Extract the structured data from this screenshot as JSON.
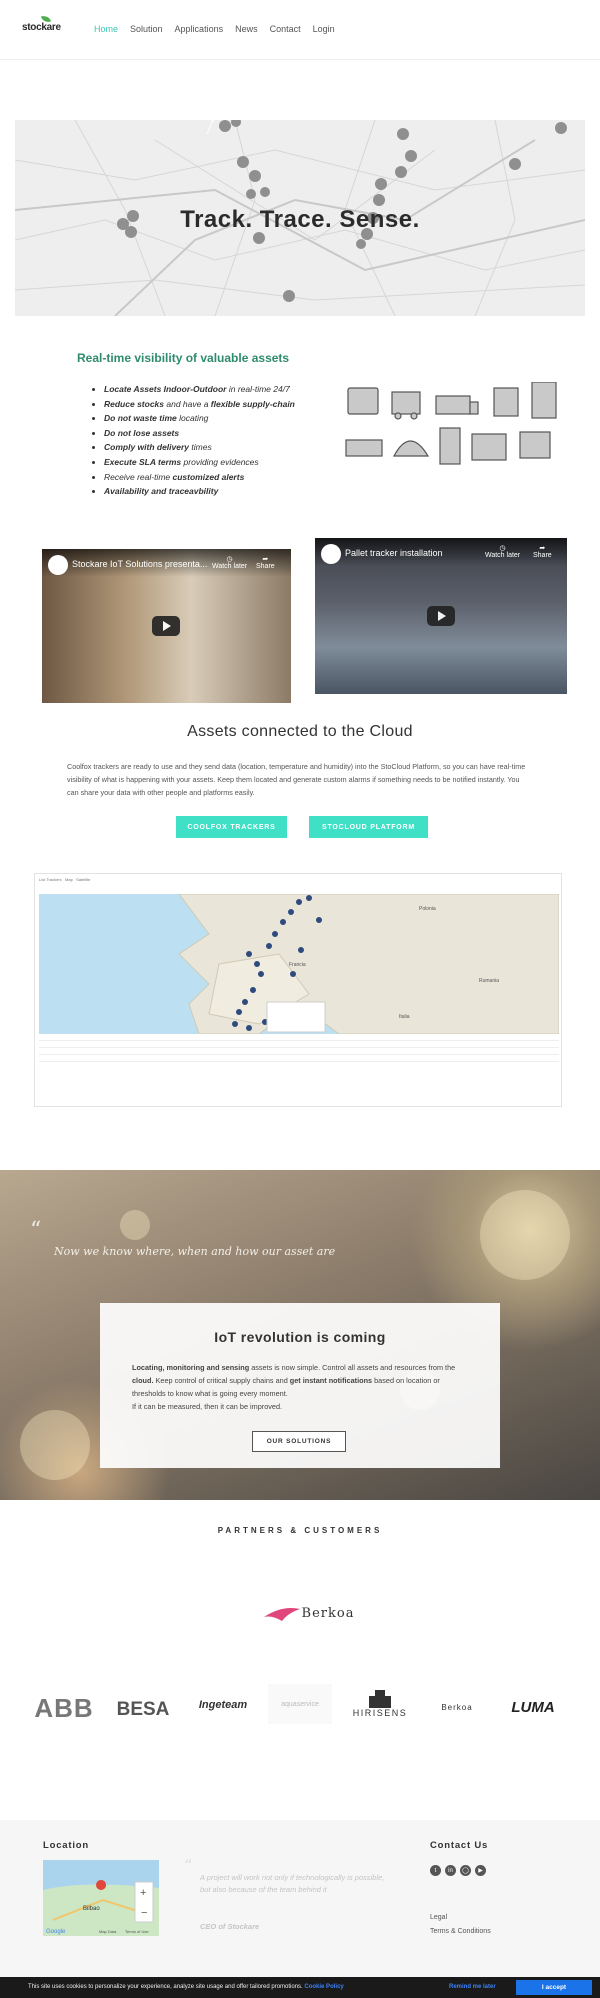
{
  "header": {
    "logo": "stockare",
    "nav": [
      "Home",
      "Solution",
      "Applications",
      "News",
      "Contact",
      "Login"
    ]
  },
  "hero": {
    "title": "Track. Trace. Sense."
  },
  "assets": {
    "title": "Real-time visibility of valuable assets",
    "items": [
      {
        "bold": "Locate Assets Indoor-Outdoor",
        "rest": " in real-time 24/7",
        "bold2": ""
      },
      {
        "bold": "Reduce stocks",
        "rest": " and have a ",
        "bold2": "flexible supply-chain"
      },
      {
        "bold": "Do not waste time",
        "rest": " locating",
        "bold2": ""
      },
      {
        "bold": "Do not lose assets",
        "rest": "",
        "bold2": ""
      },
      {
        "bold": "Comply with delivery",
        "rest": " times",
        "bold2": ""
      },
      {
        "bold": "Execute SLA terms",
        "rest": " providing evidences",
        "bold2": ""
      },
      {
        "bold": "",
        "rest": "Receive real-time ",
        "bold2": "customized alerts"
      },
      {
        "bold": "Availability and traceavbility",
        "rest": "",
        "bold2": ""
      }
    ]
  },
  "videos": [
    {
      "title": "Stockare IoT Solutions presenta...",
      "watch_later": "Watch later",
      "share": "Share"
    },
    {
      "title": "Pallet tracker installation",
      "watch_later": "Watch later",
      "share": "Share"
    }
  ],
  "cloud": {
    "title": "Assets connected to the Cloud",
    "text": "Coolfox trackers are ready to use and they send data (location, temperature and humidity) into the StoCloud Platform, so you can have real-time visibility of what is happening with your assets. Keep them located and generate custom alarms if something needs to be notified instantly. You can share your data with other people and platforms easily.",
    "btn1": "COOLFOX TRACKERS",
    "btn2": "STOCLOUD PLATFORM"
  },
  "dashboard": {
    "tabs": [
      "List Trackers",
      "Map",
      "Satellite"
    ],
    "countries": [
      "Polonia",
      "Francia",
      "Italia",
      "Rumania"
    ]
  },
  "band": {
    "quote_mark": "“",
    "quote": "Now we know where, when and how our asset are",
    "iot_title": "IoT revolution is coming",
    "iot_p1_b1": "Locating, monitoring and sensing",
    "iot_p1_a": " assets is now simple. Control all assets and resources from the ",
    "iot_p1_b2": "cloud.",
    "iot_p1_c": " Keep control of critical supply chains and ",
    "iot_p1_b3": "get instant notifications",
    "iot_p1_d": " based on location or thresholds to know what is going every moment.",
    "iot_p2": "If it can be measured, then it can be improved.",
    "button": "OUR SOLUTIONS"
  },
  "partners": {
    "title": "PARTNERS & CUSTOMERS",
    "featured": "Berkoa",
    "logos": [
      "ABB",
      "BESA",
      "Ingeteam",
      "aquaservice",
      "HIRISENS",
      "Berkoa",
      "LUMA"
    ]
  },
  "footer": {
    "location_title": "Location",
    "map_city": "Bilbao",
    "map_google": "Google",
    "map_data": "Map Data",
    "map_terms": "Terms of Use",
    "quote_mark": "“",
    "quote": "A project will work not only if technologically is possible, but also because of the team behind it",
    "ceo": "CEO of Stockare",
    "contact_title": "Contact Us",
    "links": [
      "Legal",
      "Terms & Conditions"
    ]
  },
  "cookie": {
    "text": "This site uses cookies to personalize your experience, analyze site usage and offer tailored promotions.",
    "policy": "Cookie Policy",
    "remind": "Remind me later",
    "accept": "I accept"
  },
  "colors": {
    "accent": "#3cc8b4",
    "button_teal": "#3fe0c5",
    "heading_green": "#2e8b6e",
    "cookie_blue": "#1a73e8"
  }
}
